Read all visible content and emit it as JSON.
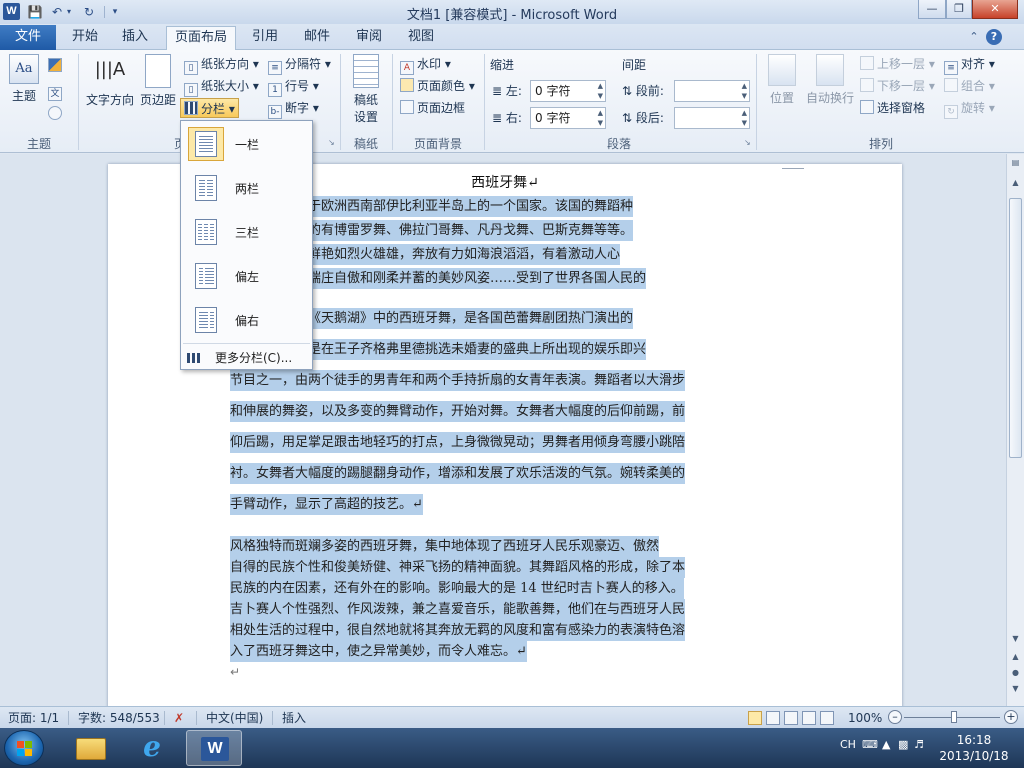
{
  "window": {
    "title": "文档1 [兼容模式] - Microsoft Word",
    "app_icon": "W"
  },
  "qat": {
    "save": "save-icon",
    "undo": "undo-icon",
    "redo": "redo-icon",
    "customize": "customize-icon"
  },
  "tabs": {
    "file": "文件",
    "items": [
      "开始",
      "插入",
      "页面布局",
      "引用",
      "邮件",
      "审阅",
      "视图"
    ],
    "active": "页面布局"
  },
  "ribbon": {
    "theme_group": {
      "label": "主题",
      "theme_btn": "主题",
      "colors_icon": "theme-colors-icon",
      "fonts_btn": "文",
      "effects_icon": "theme-effects-icon"
    },
    "page_setup": {
      "label": "页",
      "text_direction": "文字方向",
      "margins": "页边距",
      "orientation": "纸张方向",
      "size": "纸张大小",
      "columns": "分栏",
      "breaks": "分隔符",
      "line_numbers": "行号",
      "hyphenation": "断字"
    },
    "manuscript": {
      "label": "稿纸",
      "btn_line1": "稿纸",
      "btn_line2": "设置"
    },
    "background": {
      "label": "页面背景",
      "watermark": "水印",
      "page_color": "页面颜色",
      "page_border": "页面边框"
    },
    "paragraph": {
      "label": "段落",
      "indent_title": "缩进",
      "left_label": "左:",
      "left_value": "0 字符",
      "right_label": "右:",
      "right_value": "0 字符",
      "spacing_title": "间距",
      "before_label": "段前:",
      "before_value": "",
      "after_label": "段后:",
      "after_value": ""
    },
    "arrange": {
      "label": "排列",
      "position": "位置",
      "wrap": "自动换行",
      "bring_forward": "上移一层",
      "send_backward": "下移一层",
      "selection_pane": "选择窗格",
      "align": "对齐",
      "group": "组合",
      "rotate": "旋转"
    }
  },
  "columns_menu": {
    "items": [
      {
        "label": "一栏",
        "cols": 1,
        "active": true
      },
      {
        "label": "两栏",
        "cols": 2,
        "active": false
      },
      {
        "label": "三栏",
        "cols": 3,
        "active": false
      },
      {
        "label": "偏左",
        "cols": "left",
        "active": false
      },
      {
        "label": "偏右",
        "cols": "right",
        "active": false
      }
    ],
    "more": "更多分栏(C)..."
  },
  "document": {
    "title": "西班牙舞↵",
    "lines": [
      {
        "text": "西班牙，是位于欧洲西南部伊比利亚半岛上的一个国家。该国的舞蹈种",
        "sel": true
      },
      {
        "text": "类繁多，主要的有博雷罗舞、佛拉门哥舞、凡丹戈舞、巴斯克舞等等。",
        "sel": true
      },
      {
        "text": "这些舞蹈热烈鲜艳如烈火雄雄，奔放有力如海浪滔滔，有着激动人心",
        "sel": true
      },
      {
        "text": "的节奏，有着端庄自傲和刚柔并蓄的美妙风姿……受到了世界各国人民的",
        "sel": true
      },
      {
        "text": "喜爱。↵",
        "sel": true
      },
      {
        "text": "古典芭蕾舞剧《天鹅湖》中的西班牙舞，是各国芭蕾舞剧团热门演出的",
        "sel": true
      },
      {
        "text": "节目。它最初是在王子齐格弗里德挑选未婚妻的盛典上所出现的娱乐即兴",
        "sel": true
      },
      {
        "text": "节目之一，由两个徒手的男青年和两个手持折扇的女青年表演。舞蹈者以大滑步",
        "sel": true
      },
      {
        "text": "和伸展的舞姿，以及多变的舞臂动作，开始对舞。女舞者大幅度的后仰前踢，前",
        "sel": true
      },
      {
        "text": "仰后踢，用足掌足跟击地轻巧的打点，上身微微晃动；男舞者用倾身弯腰小跳陪",
        "sel": true
      },
      {
        "text": "衬。女舞者大幅度的踢腿翻身动作，增添和发展了欢乐活泼的气氛。婉转柔美的",
        "sel": true
      },
      {
        "text": "手臂动作，显示了高超的技艺。↵",
        "sel": true
      },
      {
        "text": "    风格独特而斑斓多姿的西班牙舞，集中地体现了西班牙人民乐观豪迈、傲然",
        "sel": true
      },
      {
        "text": "自得的民族个性和俊美矫健、神采飞扬的精神面貌。其舞蹈风格的形成，除了本",
        "sel": true
      },
      {
        "text": "民族的内在因素，还有外在的影响。影响最大的是 14 世纪时吉卜赛人的移入。",
        "sel": true
      },
      {
        "text": "吉卜赛人个性强烈、作风泼辣，兼之喜爱音乐，能歌善舞，他们在与西班牙人民",
        "sel": true
      },
      {
        "text": "相处生活的过程中，很自然地就将其奔放无羁的风度和富有感染力的表演特色溶",
        "sel": true
      },
      {
        "text": "入了西班牙舞这中，使之异常美妙，而令人难忘。↵",
        "sel": true
      }
    ],
    "trailing_mark": "↵"
  },
  "status": {
    "page": "页面: 1/1",
    "words": "字数: 548/553",
    "language": "中文(中国)",
    "mode": "插入",
    "zoom": "100%"
  },
  "taskbar": {
    "apps": [
      "explorer-icon",
      "ie-icon",
      "word-icon"
    ],
    "ime": "CH",
    "time": "16:18",
    "date": "2013/10/18"
  },
  "colors": {
    "accent": "#2b579a",
    "selection": "#b4cfea",
    "file_tab": "#2a63ad"
  }
}
